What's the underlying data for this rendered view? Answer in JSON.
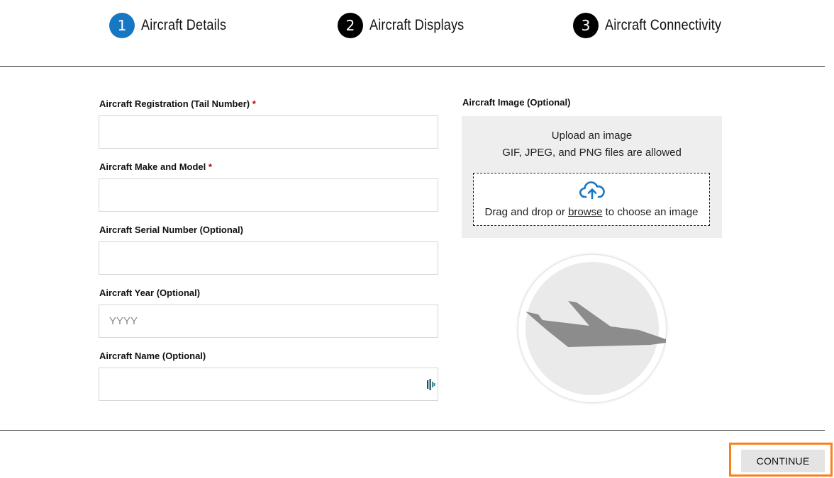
{
  "stepper": {
    "steps": [
      {
        "number": "1",
        "label": "Aircraft Details",
        "active": true
      },
      {
        "number": "2",
        "label": "Aircraft Displays",
        "active": false
      },
      {
        "number": "3",
        "label": "Aircraft Connectivity",
        "active": false
      }
    ]
  },
  "form": {
    "registration": {
      "label": "Aircraft Registration (Tail Number)",
      "required_mark": "*",
      "value": ""
    },
    "make_model": {
      "label": "Aircraft Make and Model",
      "required_mark": "*",
      "value": ""
    },
    "serial": {
      "label": "Aircraft Serial Number (Optional)",
      "value": ""
    },
    "year": {
      "label": "Aircraft Year (Optional)",
      "placeholder": "YYYY",
      "value": ""
    },
    "name": {
      "label": "Aircraft Name (Optional)",
      "value": ""
    }
  },
  "upload": {
    "title": "Aircraft Image (Optional)",
    "line1": "Upload an image",
    "line2": "GIF, JPEG, and PNG files are allowed",
    "drop_text_before": "Drag and drop or ",
    "browse_label": "browse",
    "drop_text_after": " to choose an image"
  },
  "footer": {
    "continue_label": "CONTINUE"
  },
  "colors": {
    "active_step": "#1877c2",
    "inactive_step": "#000000",
    "required": "#c00000",
    "upload_icon": "#1877c2",
    "highlight": "#f5841f"
  },
  "icons": {
    "upload": "cloud-upload-icon",
    "placeholder_image": "airplane-icon",
    "field_extension": "password-manager-icon"
  }
}
